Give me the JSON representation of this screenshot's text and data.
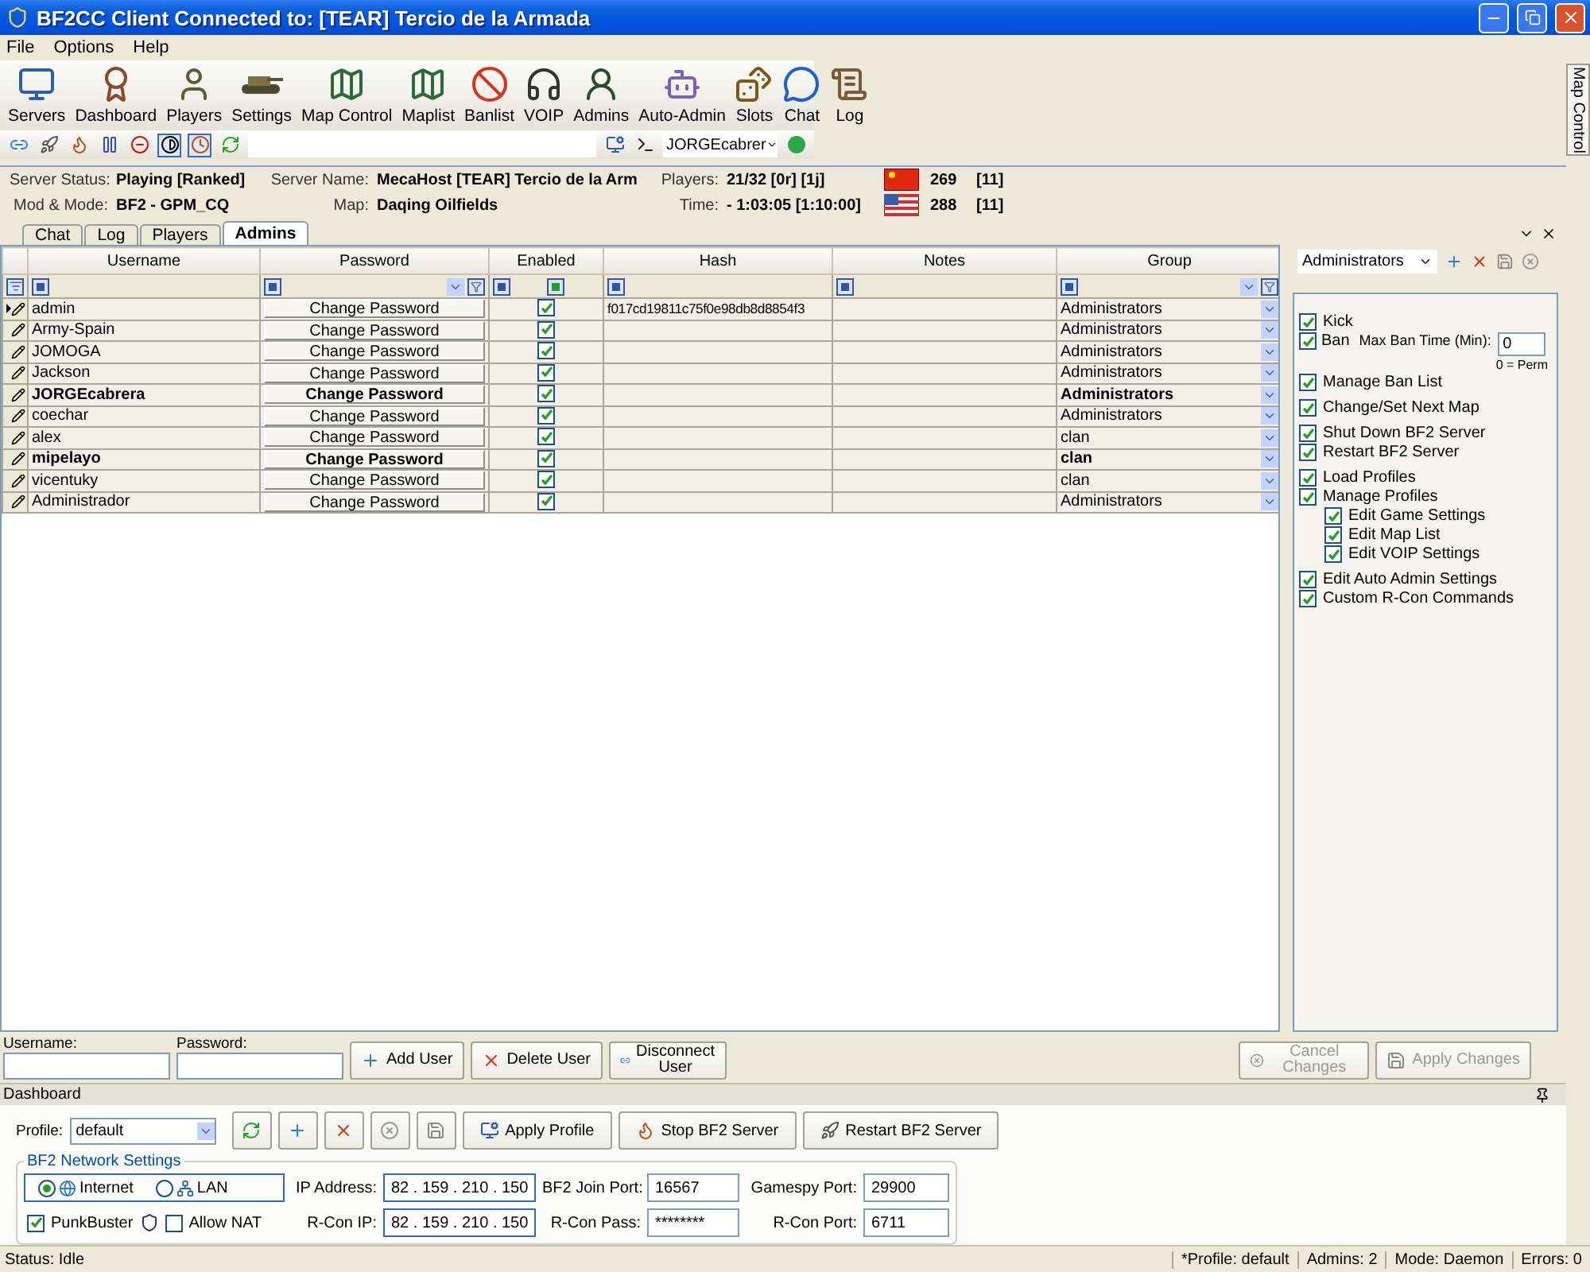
{
  "window": {
    "title": "BF2CC Client Connected to: [TEAR] Tercio de la Armada"
  },
  "menu": [
    "File",
    "Options",
    "Help"
  ],
  "toolbar": [
    {
      "label": "Servers"
    },
    {
      "label": "Dashboard"
    },
    {
      "label": "Players"
    },
    {
      "label": "Settings"
    },
    {
      "label": "Map Control"
    },
    {
      "label": "Maplist"
    },
    {
      "label": "Banlist"
    },
    {
      "label": "VOIP"
    },
    {
      "label": "Admins"
    },
    {
      "label": "Auto-Admin"
    },
    {
      "label": "Slots"
    },
    {
      "label": "Chat"
    },
    {
      "label": "Log"
    }
  ],
  "quick_bar": {
    "user": "JORGEcabrer"
  },
  "side_tab": "Map Control",
  "server_info": {
    "rows": [
      [
        {
          "label": "Server Status:",
          "value": "Playing [Ranked]"
        },
        {
          "label": "Server Name:",
          "value": "MecaHost [TEAR] Tercio de la Arm"
        },
        {
          "label": "Players:",
          "value": "21/32 [0r] [1j]"
        }
      ],
      [
        {
          "label": "Mod & Mode:",
          "value": "BF2 - GPM_CQ"
        },
        {
          "label": "Map:",
          "value": "Daqing Oilfields"
        },
        {
          "label": "Time:",
          "value": "- 1:03:05 [1:10:00]"
        }
      ]
    ],
    "teams": [
      {
        "kind": "china",
        "score": "269",
        "tickets": "[11]"
      },
      {
        "kind": "usa",
        "score": "288",
        "tickets": "[11]"
      }
    ]
  },
  "tabs": [
    {
      "label": "Chat",
      "selected": false
    },
    {
      "label": "Log",
      "selected": false
    },
    {
      "label": "Players",
      "selected": false
    },
    {
      "label": "Admins",
      "selected": true
    }
  ],
  "table": {
    "columns": [
      "Username",
      "Password",
      "Enabled",
      "Hash",
      "Notes",
      "Group"
    ],
    "rows": [
      {
        "username": "admin",
        "password": "Change Password",
        "enabled": true,
        "hash": "f017cd19811c75f0e98db8d8854f3",
        "group": "Administrators",
        "online": false,
        "selected": true
      },
      {
        "username": "Army-Spain",
        "password": "Change Password",
        "enabled": true,
        "group": "Administrators",
        "online": false,
        "selected": false
      },
      {
        "username": "JOMOGA",
        "password": "Change Password",
        "enabled": true,
        "group": "Administrators",
        "online": false,
        "selected": false
      },
      {
        "username": "Jackson",
        "password": "Change Password",
        "enabled": true,
        "group": "Administrators",
        "online": false,
        "selected": false
      },
      {
        "username": "JORGEcabrera",
        "password": "Change Password",
        "enabled": true,
        "group": "Administrators",
        "online": true,
        "selected": false
      },
      {
        "username": "coechar",
        "password": "Change Password",
        "enabled": true,
        "group": "Administrators",
        "online": false,
        "selected": false
      },
      {
        "username": "alex",
        "password": "Change Password",
        "enabled": true,
        "group": "clan",
        "online": false,
        "selected": false
      },
      {
        "username": "mipelayo",
        "password": "Change Password",
        "enabled": true,
        "group": "clan",
        "online": true,
        "selected": false
      },
      {
        "username": "vicentuky",
        "password": "Change Password",
        "enabled": true,
        "group": "clan",
        "online": false,
        "selected": false
      },
      {
        "username": "Administrador",
        "password": "Change Password",
        "enabled": true,
        "group": "Administrators",
        "online": false,
        "selected": false
      }
    ]
  },
  "group_panel": {
    "group": "Administrators",
    "permission_groups": [
      {
        "items": [
          {
            "label": "Kick",
            "checked": true
          },
          {
            "label": "Ban",
            "checked": true,
            "limit": {
              "label": "Max Ban Time (Min):",
              "value": "0",
              "hint": "0 = Perm"
            }
          },
          {
            "label": "Manage Ban List",
            "checked": true
          }
        ]
      },
      {
        "items": [
          {
            "label": "Change/Set Next Map",
            "checked": true
          }
        ]
      },
      {
        "items": [
          {
            "label": "Shut Down BF2 Server",
            "checked": true
          },
          {
            "label": "Restart BF2 Server",
            "checked": true
          }
        ]
      },
      {
        "items": [
          {
            "label": "Load Profiles",
            "checked": true
          },
          {
            "label": "Manage Profiles",
            "checked": true,
            "children": [
              {
                "label": "Edit Game Settings",
                "checked": true
              },
              {
                "label": "Edit Map List",
                "checked": true
              },
              {
                "label": "Edit VOIP Settings",
                "checked": true
              }
            ]
          }
        ]
      },
      {
        "items": [
          {
            "label": "Edit Auto Admin Settings",
            "checked": true
          },
          {
            "label": "Custom R-Con Commands",
            "checked": true
          }
        ]
      }
    ],
    "buttons": [
      {
        "label": "Cancel Changes",
        "disabled": true
      },
      {
        "label": "Apply Changes",
        "disabled": true
      }
    ]
  },
  "user_form": {
    "fields": [
      {
        "label": "Username:"
      },
      {
        "label": "Password:"
      }
    ],
    "buttons": [
      {
        "label": "Add User"
      },
      {
        "label": "Delete User"
      },
      {
        "label": "Disconnect User"
      }
    ]
  },
  "dashboard": {
    "title": "Dashboard",
    "profile": {
      "label": "Profile:",
      "value": "default"
    },
    "buttons": [
      {
        "label": "Apply Profile"
      },
      {
        "label": "Stop BF2 Server"
      },
      {
        "label": "Restart BF2 Server"
      }
    ],
    "network": {
      "title": "BF2 Network Settings",
      "modes": [
        {
          "label": "Internet",
          "selected": true
        },
        {
          "label": "LAN",
          "selected": false
        }
      ],
      "punkbuster": {
        "label": "PunkBuster",
        "checked": true
      },
      "allow_nat": {
        "label": "Allow NAT",
        "checked": false
      },
      "fields": [
        {
          "kind": "ip",
          "label": "IP Address:",
          "value": "82 . 159 . 210 . 150"
        },
        {
          "kind": "text",
          "label": "BF2 Join Port:",
          "value": "16567"
        },
        {
          "kind": "text",
          "label": "Gamespy Port:",
          "value": "29900"
        },
        {
          "kind": "ip",
          "label": "R-Con IP:",
          "value": "82 . 159 . 210 . 150"
        },
        {
          "kind": "text",
          "label": "R-Con Pass:",
          "value": "********"
        },
        {
          "kind": "text",
          "label": "R-Con Port:",
          "value": "6711"
        }
      ]
    }
  },
  "status_bar": {
    "status": "Status: Idle",
    "panes": [
      "*Profile: default",
      "Admins: 2",
      "Mode: Daemon",
      "Errors: 0"
    ]
  }
}
